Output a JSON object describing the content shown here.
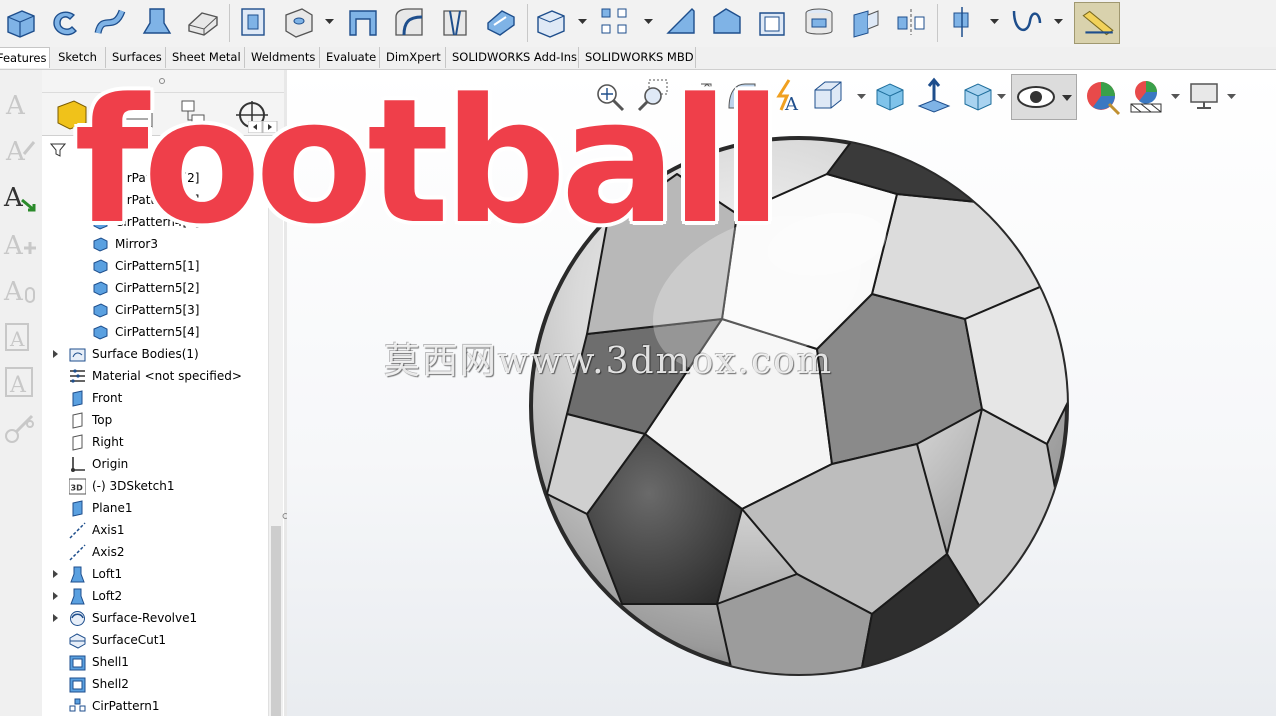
{
  "command_tabs": [
    {
      "label": "Features",
      "active": true
    },
    {
      "label": "Sketch"
    },
    {
      "label": "Surfaces"
    },
    {
      "label": "Sheet Metal"
    },
    {
      "label": "Weldments"
    },
    {
      "label": "Evaluate"
    },
    {
      "label": "DimXpert"
    },
    {
      "label": "SOLIDWORKS Add-Ins"
    },
    {
      "label": "SOLIDWORKS MBD"
    }
  ],
  "toolbar_icons": [
    "extruded-boss-icon",
    "revolved-boss-icon",
    "swept-boss-icon",
    "lofted-boss-icon",
    "boundary-boss-icon",
    "extruded-cut-icon",
    "hole-wizard-icon",
    "revolved-cut-icon",
    "swept-cut-icon",
    "lofted-cut-icon",
    "boundary-cut-icon",
    "fillet-icon",
    "linear-pattern-icon",
    "rib-icon",
    "draft-icon",
    "shell-icon",
    "wrap-icon",
    "intersect-icon",
    "mirror-icon",
    "reference-geometry-icon",
    "curves-icon",
    "instant3d-icon"
  ],
  "task_strip_icons": [
    "smart-dimension-icon",
    "sketch-icon",
    "annotation-icon",
    "add-note-icon",
    "balloon-icon",
    "auto-balloon-icon",
    "weld-symbol-icon",
    "hole-callout-icon"
  ],
  "feature_manager_tabs": [
    "featuremanager-tab-icon",
    "propertymanager-tab-icon",
    "configurationmanager-tab-icon",
    "dimxpertmanager-tab-icon"
  ],
  "feature_tree": [
    {
      "label": "CirPattern4[2]",
      "icon": "solid-body-icon"
    },
    {
      "label": "CirPattern4[3]",
      "icon": "solid-body-icon"
    },
    {
      "label": "CirPattern4[4]",
      "icon": "solid-body-icon"
    },
    {
      "label": "Mirror3",
      "icon": "solid-body-icon"
    },
    {
      "label": "CirPattern5[1]",
      "icon": "solid-body-icon"
    },
    {
      "label": "CirPattern5[2]",
      "icon": "solid-body-icon"
    },
    {
      "label": "CirPattern5[3]",
      "icon": "solid-body-icon"
    },
    {
      "label": "CirPattern5[4]",
      "icon": "solid-body-icon"
    },
    {
      "label": "Surface Bodies(1)",
      "icon": "surface-bodies-folder-icon",
      "expandable": true
    },
    {
      "label": "Material <not specified>",
      "icon": "material-icon"
    },
    {
      "label": "Front",
      "icon": "plane-icon"
    },
    {
      "label": "Top",
      "icon": "plane-icon"
    },
    {
      "label": "Right",
      "icon": "plane-icon"
    },
    {
      "label": "Origin",
      "icon": "origin-icon"
    },
    {
      "label": "(-) 3DSketch1",
      "icon": "3d-sketch-icon"
    },
    {
      "label": "Plane1",
      "icon": "plane-icon"
    },
    {
      "label": "Axis1",
      "icon": "axis-icon"
    },
    {
      "label": "Axis2",
      "icon": "axis-icon"
    },
    {
      "label": "Loft1",
      "icon": "loft-icon",
      "expandable": true
    },
    {
      "label": "Loft2",
      "icon": "loft-icon",
      "expandable": true
    },
    {
      "label": "Surface-Revolve1",
      "icon": "surface-revolve-icon",
      "expandable": true
    },
    {
      "label": "SurfaceCut1",
      "icon": "surface-cut-icon"
    },
    {
      "label": "Shell1",
      "icon": "shell-icon"
    },
    {
      "label": "Shell2",
      "icon": "shell-icon"
    },
    {
      "label": "CirPattern1",
      "icon": "circular-pattern-icon"
    }
  ],
  "heads_up_icons": [
    "zoom-to-fit-icon",
    "zoom-to-area-icon",
    "previous-view-icon",
    "section-view-icon",
    "dynamic-annotation-icon",
    "view-orientation-icon",
    "display-style-icon",
    "hide-show-items-icon",
    "edit-appearance-icon",
    "apply-scene-icon",
    "view-settings-icon"
  ],
  "watermark": "莫西网www.3dmox.com",
  "overlay_title": "football",
  "colors": {
    "title_red": "#ef3f4a",
    "toolbar_blue": "#3a78c2"
  }
}
